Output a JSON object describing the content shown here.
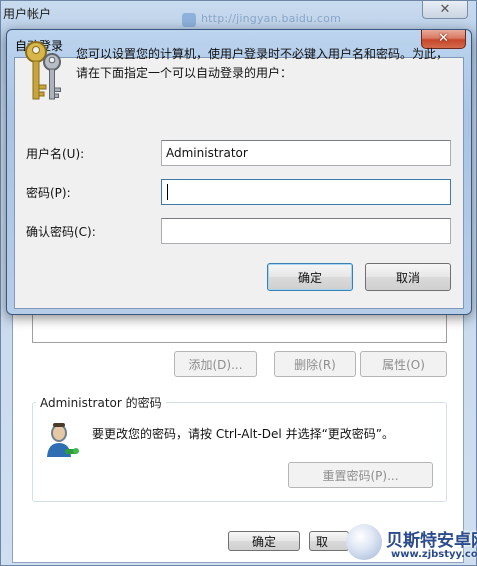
{
  "background_window": {
    "title": "用户帐户",
    "address_text": "http://jingyan.baidu.com",
    "close_glyph": "✕",
    "user_buttons": {
      "add": "添加(D)...",
      "remove": "删除(R)",
      "properties": "属性(O)"
    },
    "password_group": {
      "title": "Administrator 的密码",
      "message": "要更改您的密码，请按 Ctrl-Alt-Del 并选择“更改密码”。",
      "reset_button": "重置密码(P)...",
      "icon": "user-key-icon"
    },
    "footer": {
      "ok": "确定",
      "cancel_partial": "取"
    }
  },
  "dialog": {
    "title": "自动登录",
    "close_glyph": "✕",
    "icon": "keys-icon",
    "info_line1": "您可以设置您的计算机，使用户登录时不必键入用户名和密码。为此，",
    "info_line2": "请在下面指定一个可以自动登录的用户：",
    "fields": {
      "username": {
        "label": "用户名(U):",
        "value": "Administrator"
      },
      "password": {
        "label": "密码(P):",
        "value": ""
      },
      "confirm": {
        "label": "确认密码(C):",
        "value": ""
      }
    },
    "ok_button": "确定",
    "cancel_button": "取消"
  },
  "watermark": {
    "title": "贝斯特安卓网",
    "url": "www.zjbstyy.com"
  },
  "colors": {
    "dialog_frame": "#a9c4e4",
    "close_red": "#c7462a",
    "focus_border": "#3d7bad"
  }
}
